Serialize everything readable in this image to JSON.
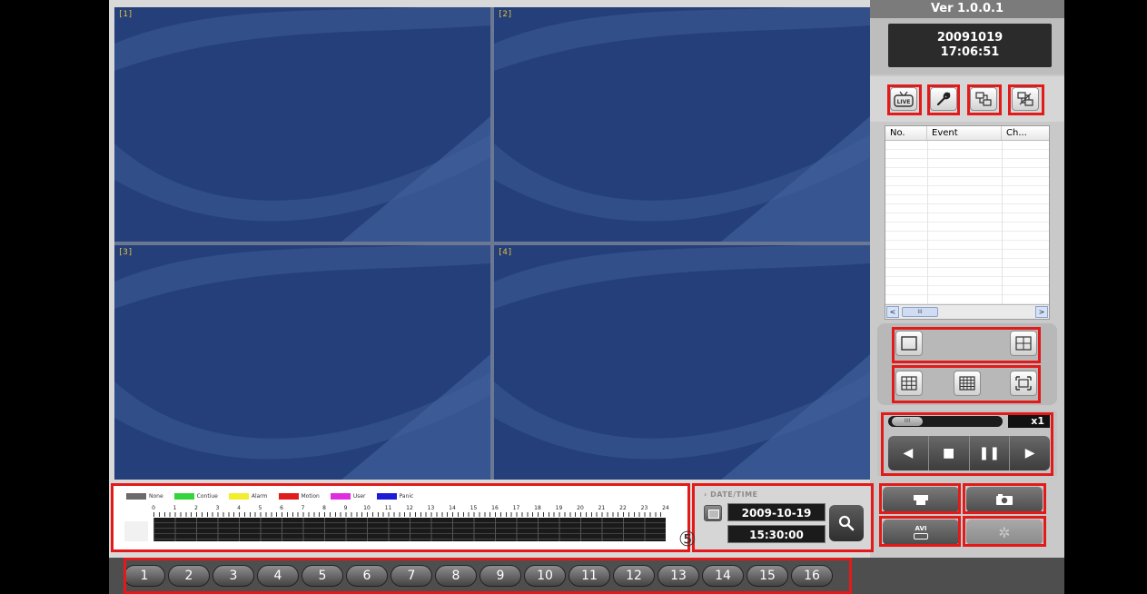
{
  "version": "Ver 1.0.0.1",
  "clock": {
    "date": "20091019",
    "time": "17:06:51"
  },
  "toolbar_icons": [
    "live-icon",
    "wrench-icon",
    "network-icon",
    "disconnect-icon"
  ],
  "live_label": "LIVE",
  "cameras": [
    "[1]",
    "[2]",
    "[3]",
    "[4]"
  ],
  "event_table": {
    "columns": [
      "No.",
      "Event",
      "Ch..."
    ],
    "scroll_label": "III"
  },
  "layout_icons": [
    "single-view-icon",
    "quad-view-icon",
    "nine-view-icon",
    "sixteen-view-icon",
    "fullscreen-icon"
  ],
  "playback": {
    "speed": "x1",
    "slider_label": "IIII"
  },
  "legend": [
    {
      "label": "None",
      "color": "#6b6b6b"
    },
    {
      "label": "Contiue",
      "color": "#35d43a"
    },
    {
      "label": "Alarm",
      "color": "#f2ee2c"
    },
    {
      "label": "Motion",
      "color": "#e01c1c"
    },
    {
      "label": "User",
      "color": "#e02ce0"
    },
    {
      "label": "Panic",
      "color": "#1c1cd6"
    }
  ],
  "hours": [
    "0",
    "1",
    "2",
    "3",
    "4",
    "5",
    "6",
    "7",
    "8",
    "9",
    "10",
    "11",
    "12",
    "13",
    "14",
    "15",
    "16",
    "17",
    "18",
    "19",
    "20",
    "21",
    "22",
    "23",
    "24"
  ],
  "datetime": {
    "label": "DATE/TIME",
    "date": "2009-10-19",
    "time": "15:30:00"
  },
  "annotation": "⑤",
  "action_buttons": {
    "avi_label": "AVI"
  },
  "channels": [
    "1",
    "2",
    "3",
    "4",
    "5",
    "6",
    "7",
    "8",
    "9",
    "10",
    "11",
    "12",
    "13",
    "14",
    "15",
    "16"
  ],
  "colors": {
    "highlight": "#e31a1a",
    "active_camera": "#f2ea3a",
    "video_bg": "#243f7a"
  }
}
